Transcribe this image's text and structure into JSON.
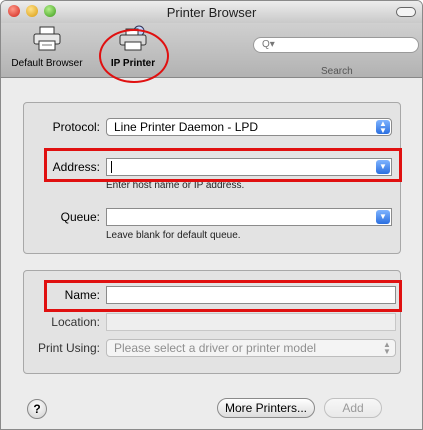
{
  "window": {
    "title": "Printer Browser"
  },
  "toolbar": {
    "default_browser": {
      "label": "Default Browser",
      "icon": "printer-icon"
    },
    "ip_printer": {
      "label": "IP Printer",
      "icon": "network-printer-icon"
    },
    "search": {
      "label": "Search",
      "value": ""
    }
  },
  "form": {
    "protocol": {
      "label": "Protocol:",
      "value": "Line Printer Daemon - LPD"
    },
    "address": {
      "label": "Address:",
      "value": "",
      "hint": "Enter host name or IP address."
    },
    "queue": {
      "label": "Queue:",
      "value": "",
      "hint": "Leave blank for default queue."
    },
    "name": {
      "label": "Name:",
      "value": ""
    },
    "location": {
      "label": "Location:",
      "value": ""
    },
    "print_using": {
      "label": "Print Using:",
      "value": "Please select a driver or printer model"
    }
  },
  "footer": {
    "help_label": "?",
    "more_printers_label": "More Printers...",
    "add_label": "Add"
  },
  "colors": {
    "highlight": "#e01010",
    "accent": "#2a6fe0"
  }
}
